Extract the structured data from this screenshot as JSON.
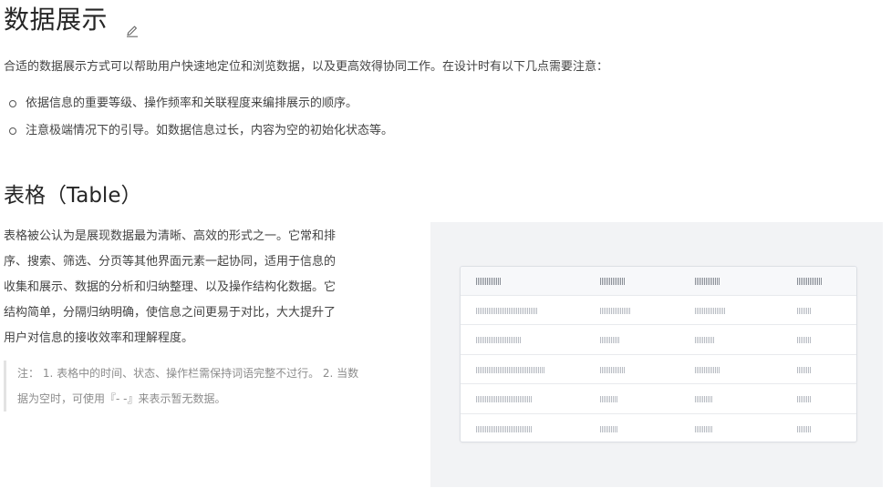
{
  "section1": {
    "title": "数据展示",
    "intro": "合适的数据展示方式可以帮助用户快速地定位和浏览数据，以及更高效得协同工作。在设计时有以下几点需要注意：",
    "bullets": [
      "依据信息的重要等级、操作频率和关联程度来编排展示的顺序。",
      "注意极端情况下的引导。如数据信息过长，内容为空的初始化状态等。"
    ]
  },
  "section2": {
    "title": "表格（Table）",
    "body_lines": [
      "表格被公认为是展现数据最为清晰、高效的形式之一。它常和排",
      "序、搜索、筛选、分页等其他界面元素一起协同，适用于信息的",
      "收集和展示、数据的分析和归纳整理、以及操作结构化数据。它",
      "结构简单，分隔归纳明确，使信息之间更易于对比，大大提升了",
      "用户对信息的接收效率和理解程度。"
    ],
    "note_lines": [
      "注： 1. 表格中的时间、状态、操作栏需保持词语完整不过行。 2. 当数",
      "据为空时，可使用『- -』来表示暂无数据。"
    ]
  },
  "icons": {
    "edit": "pencil-edit-icon"
  },
  "colors": {
    "preview_bg": "#f2f3f5",
    "table_border": "#dcdfe4",
    "placeholder_bar": "#b8bcc3"
  }
}
